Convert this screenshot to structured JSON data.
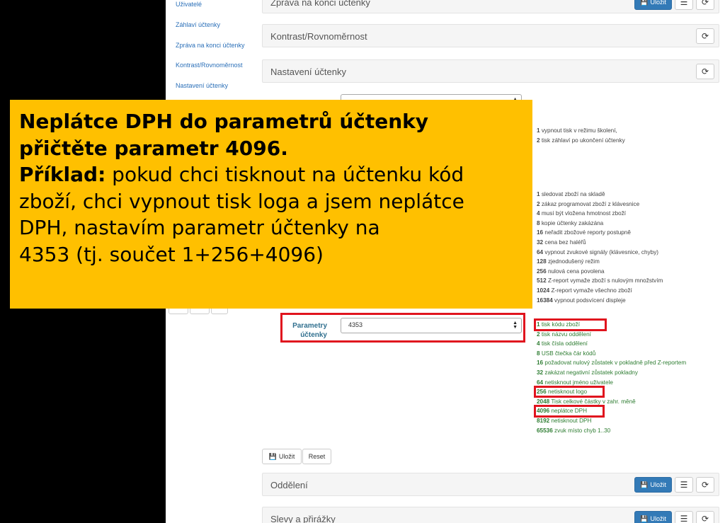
{
  "sidebar": {
    "items": [
      {
        "label": "Uživatelé"
      },
      {
        "label": "Záhlaví účtenky"
      },
      {
        "label": "Zpráva na konci účtenky"
      },
      {
        "label": "Kontrast/Rovnoměrnost"
      },
      {
        "label": "Nastavení účtenky"
      }
    ]
  },
  "panels": {
    "top_title": "Zpráva na konci účtenky",
    "kontrast_title": "Kontrast/Rovnoměrnost",
    "nastaveni_title": "Nastavení účtenky",
    "oddeleni_title": "Oddělení",
    "slevy_title": "Slevy a přirážky",
    "save_label": "Uložit"
  },
  "icons": {
    "save": "floppy-disk-icon",
    "list": "list-icon",
    "refresh": "refresh-icon"
  },
  "help_top": [
    {
      "num": "1",
      "text": " vypnout tisk v režimu školení,"
    },
    {
      "num": "2",
      "text": " tisk záhlaví po ukončení účtenky"
    }
  ],
  "help_middle": [
    {
      "num": "1",
      "text": " sledovat zboží na skladě"
    },
    {
      "num": "2",
      "text": " zákaz programovat zboží z klávesnice"
    },
    {
      "num": "4",
      "text": " musí být vložena hmotnost zboží"
    },
    {
      "num": "8",
      "text": " kopie účtenky zakázána"
    },
    {
      "num": "16",
      "text": " neřadit zbožové reporty postupně"
    },
    {
      "num": "32",
      "text": " cena bez haléřů"
    },
    {
      "num": "64",
      "text": " vypnout zvukové signály (klávesnice, chyby)"
    },
    {
      "num": "128",
      "text": " zjednodušený režim"
    },
    {
      "num": "256",
      "text": " nulová cena povolena"
    },
    {
      "num": "512",
      "text": " Z-report vymaže zboží s nulovým množstvím"
    },
    {
      "num": "1024",
      "text": " Z-report vymaže všechno zboží"
    },
    {
      "num": "16384",
      "text": " vypnout podsvícení displeje"
    }
  ],
  "receipt_params": {
    "label_line1": "Parametry",
    "label_line2": "účtenky",
    "value": "4353",
    "options": [
      {
        "num": "1",
        "text": " tisk kódu zboží"
      },
      {
        "num": "2",
        "text": " tisk názvu oddělení"
      },
      {
        "num": "4",
        "text": " tisk čísla oddělení"
      },
      {
        "num": "8",
        "text": " USB čtečka čár kódů"
      },
      {
        "num": "16",
        "text": " požadovat nulový zůstatek v pokladně před Z-reportem"
      },
      {
        "num": "32",
        "text": " zakázat negativní zůstatek pokladny"
      },
      {
        "num": "64",
        "text": " netisknout jméno uživatele"
      },
      {
        "num": "256",
        "text": " netisknout logo"
      },
      {
        "num": "2048",
        "text": " Tisk celkové částky v zahr. měně"
      },
      {
        "num": "4096",
        "text": " neplátce DPH"
      },
      {
        "num": "8192",
        "text": " netisknout DPH"
      },
      {
        "num": "65536",
        "text": " zvuk místo chyb 1..30"
      }
    ]
  },
  "form_buttons": {
    "save": "Uložit",
    "reset": "Reset"
  },
  "callout": {
    "line1": "Neplátce DPH do parametrů účtenky",
    "line2": "přičtěte parametr 4096.",
    "line3_bold": "Příklad:",
    "line3_rest": " pokud chci tisknout na účtenku kód",
    "line4": "zboží, chci vypnout tisk loga a jsem neplátce",
    "line5": "DPH, nastavím parametr účtenky na",
    "line6": "4353 (tj. součet 1+256+4096)"
  }
}
